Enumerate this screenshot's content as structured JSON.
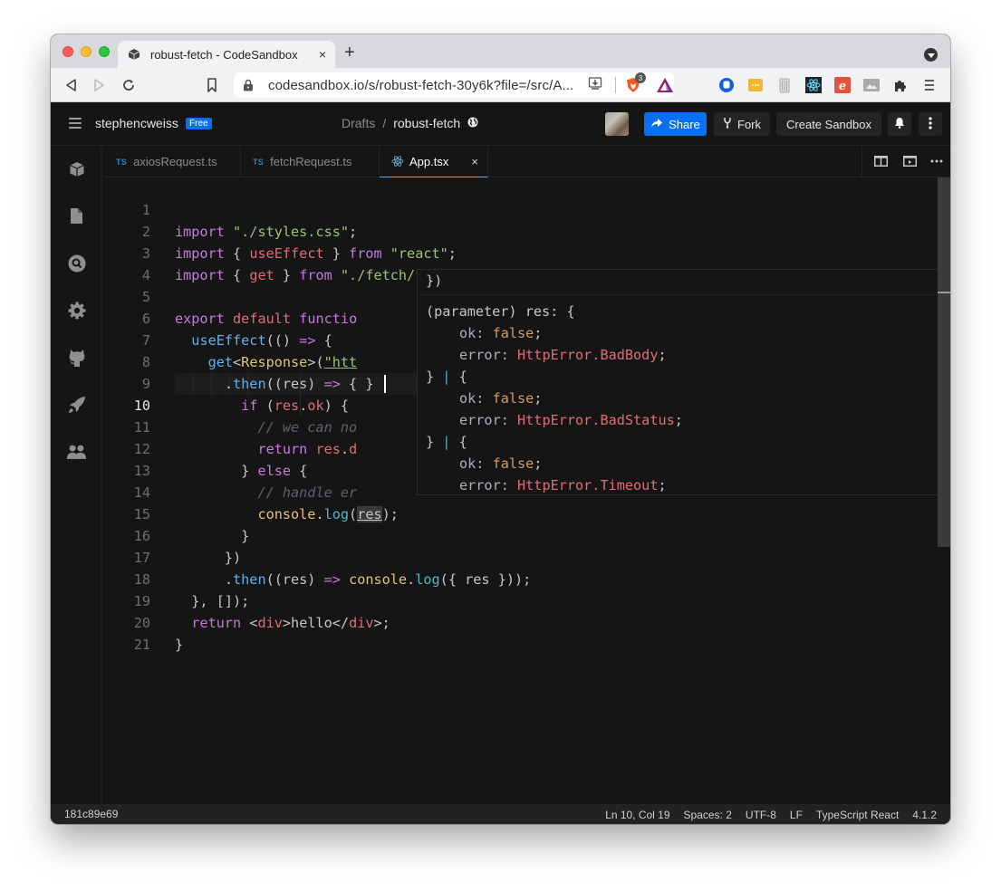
{
  "browser": {
    "tab_title": "robust-fetch - CodeSandbox",
    "tab_close": "×",
    "new_tab": "+",
    "url": "codesandbox.io/s/robust-fetch-30y6k?file=/src/A...",
    "brave_badge": "3",
    "extensions": [
      "bitwarden-icon",
      "keepassxc-icon",
      "trash-icon",
      "react-devtools-icon",
      "evernote-icon",
      "image-icon",
      "extensions-puzzle-icon",
      "menu-icon"
    ]
  },
  "header": {
    "username": "stephencweiss",
    "plan_badge": "Free",
    "breadcrumb_parent": "Drafts",
    "breadcrumb_sep": "/",
    "sandbox_name": "robust-fetch",
    "share_label": "Share",
    "fork_label": "Fork",
    "create_label": "Create Sandbox"
  },
  "activity_bar": [
    {
      "name": "sandbox-info",
      "icon": "cube-icon"
    },
    {
      "name": "explorer",
      "icon": "file-icon"
    },
    {
      "name": "search",
      "icon": "search-icon"
    },
    {
      "name": "settings",
      "icon": "gear-icon"
    },
    {
      "name": "github",
      "icon": "github-icon"
    },
    {
      "name": "deploy",
      "icon": "rocket-icon"
    },
    {
      "name": "live",
      "icon": "users-icon"
    }
  ],
  "editor_tabs": [
    {
      "label": "axiosRequest.ts",
      "lang": "TS",
      "active": false
    },
    {
      "label": "fetchRequest.ts",
      "lang": "TS",
      "active": false
    },
    {
      "label": "App.tsx",
      "lang": "react",
      "active": true,
      "close": "×"
    }
  ],
  "code": {
    "current_line": 10,
    "lines": [
      {
        "n": "1"
      },
      {
        "n": "2"
      },
      {
        "n": "3"
      },
      {
        "n": "4"
      },
      {
        "n": "5"
      },
      {
        "n": "6"
      },
      {
        "n": "7"
      },
      {
        "n": "8"
      },
      {
        "n": "9"
      },
      {
        "n": "10"
      },
      {
        "n": "11"
      },
      {
        "n": "12"
      },
      {
        "n": "13"
      },
      {
        "n": "14"
      },
      {
        "n": "15"
      },
      {
        "n": "16"
      },
      {
        "n": "17"
      },
      {
        "n": "18"
      },
      {
        "n": "19"
      },
      {
        "n": "20"
      },
      {
        "n": "21"
      }
    ],
    "tokens": {
      "l1": [
        "import",
        " \"./styles.css\"",
        ";"
      ],
      "l2": [
        "import",
        " { ",
        "useEffect",
        " } ",
        "from",
        " \"react\"",
        ";"
      ],
      "l3": [
        "import",
        " { ",
        "get",
        " } ",
        "from",
        " \"./fetch/fetchRequest\"",
        ";"
      ],
      "l5": [
        "export",
        " ",
        "default",
        " ",
        "functio"
      ],
      "l6": [
        "  ",
        "useEffect",
        "(() ",
        "=>",
        " {"
      ],
      "l7": [
        "    ",
        "get",
        "<",
        "Response",
        ">(",
        "\"htt"
      ],
      "l8": [
        "      .",
        "then",
        "((res) ",
        "=>",
        " { } "
      ],
      "l9": [
        "        ",
        "if",
        " (",
        "res",
        ".",
        "ok",
        ") {"
      ],
      "l10": [
        "          // we can no"
      ],
      "l11": [
        "          ",
        "return",
        " ",
        "res",
        ".",
        "d"
      ],
      "l12": [
        "        } ",
        "else",
        " {"
      ],
      "l13": [
        "          // handle er"
      ],
      "l14": [
        "          ",
        "console",
        ".",
        "log",
        "(",
        "res",
        ");"
      ],
      "l15": [
        "        }"
      ],
      "l16": [
        "      })"
      ],
      "l17": [
        "      .",
        "then",
        "((res) ",
        "=>",
        " ",
        "console",
        ".",
        "log",
        "({ res }));"
      ],
      "l18": [
        "  }, []);"
      ],
      "l19": [
        "  ",
        "return",
        " <",
        "div",
        ">hello</",
        "div",
        ">;"
      ],
      "l20": [
        "}"
      ]
    }
  },
  "hover": {
    "header": "})",
    "signature_prefix": "(parameter) res: {",
    "variants": [
      {
        "ok_key": "ok: ",
        "ok_val": "false",
        "err_key": "error: ",
        "err_val": "HttpError.BadBody",
        "close": "} | {"
      },
      {
        "ok_key": "ok: ",
        "ok_val": "false",
        "err_key": "error: ",
        "err_val": "HttpError.BadStatus",
        "close": "} | {"
      },
      {
        "ok_key": "ok: ",
        "ok_val": "false",
        "err_key": "error: ",
        "err_val": "HttpError.Timeout"
      }
    ]
  },
  "status": {
    "commit": "181c89e69",
    "position": "Ln 10, Col 19",
    "spaces": "Spaces: 2",
    "encoding": "UTF-8",
    "eol": "LF",
    "language": "TypeScript React",
    "ts_version": "4.1.2"
  }
}
